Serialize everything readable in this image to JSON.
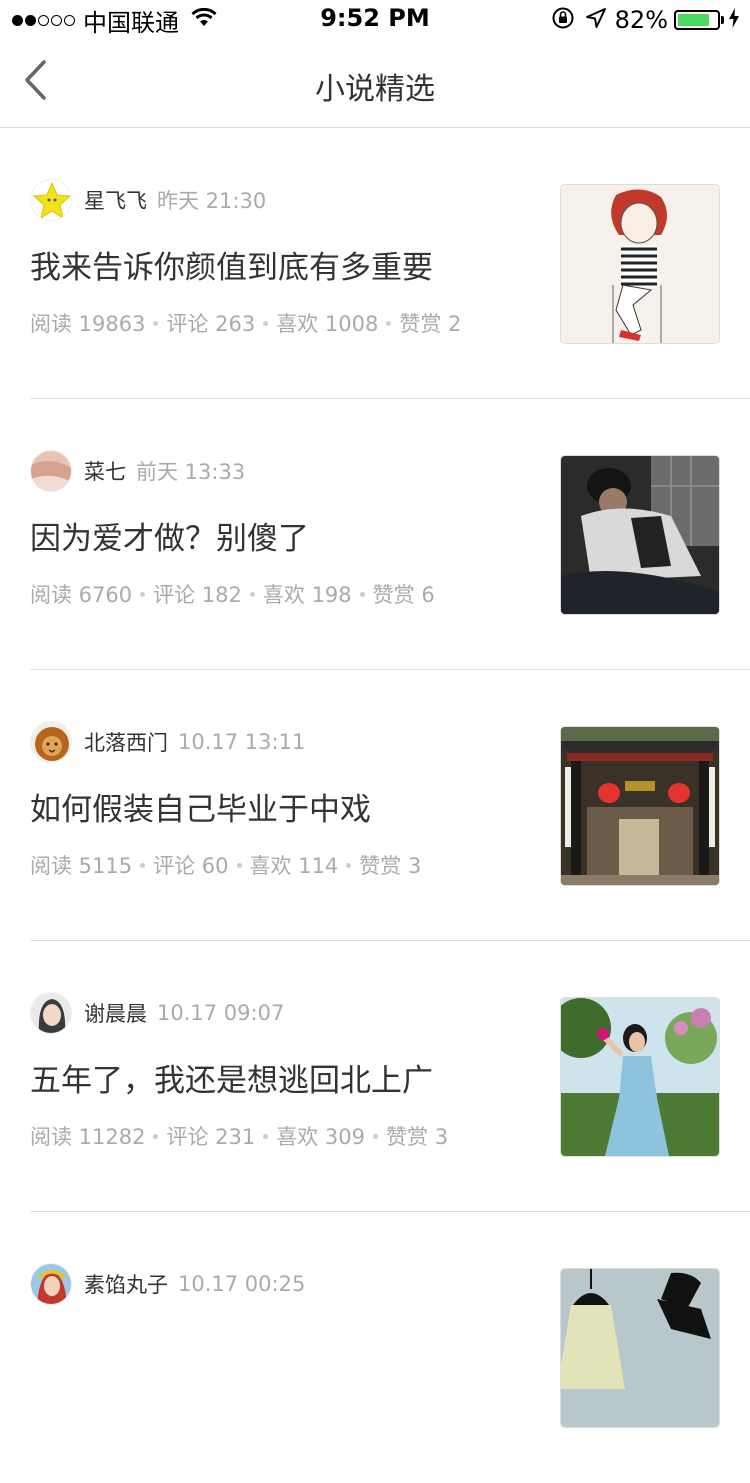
{
  "status_bar": {
    "carrier": "中国联通",
    "time": "9:52 PM",
    "battery_percent": "82%",
    "battery_level": 0.82
  },
  "nav": {
    "title": "小说精选",
    "back_icon": "chevron-left-icon"
  },
  "articles": [
    {
      "author": "星飞飞",
      "time": "昨天 21:30",
      "title": "我来告诉你颜值到底有多重要",
      "stats": {
        "read": "阅读 19863",
        "comments": "评论 263",
        "likes": "喜欢 1008",
        "rewards": "赞赏 2"
      }
    },
    {
      "author": "菜七",
      "time": "前天 13:33",
      "title": "因为爱才做？别傻了",
      "stats": {
        "read": "阅读 6760",
        "comments": "评论 182",
        "likes": "喜欢 198",
        "rewards": "赞赏 6"
      }
    },
    {
      "author": "北落西门",
      "time": "10.17 13:11",
      "title": "如何假装自己毕业于中戏",
      "stats": {
        "read": "阅读 5115",
        "comments": "评论 60",
        "likes": "喜欢 114",
        "rewards": "赞赏 3"
      }
    },
    {
      "author": "谢晨晨",
      "time": "10.17 09:07",
      "title": "五年了，我还是想逃回北上广",
      "stats": {
        "read": "阅读 11282",
        "comments": "评论 231",
        "likes": "喜欢 309",
        "rewards": "赞赏 3"
      }
    },
    {
      "author": "素馅丸子",
      "time": "10.17 00:25",
      "title": "",
      "stats": {
        "read": "",
        "comments": "",
        "likes": "",
        "rewards": ""
      }
    }
  ]
}
